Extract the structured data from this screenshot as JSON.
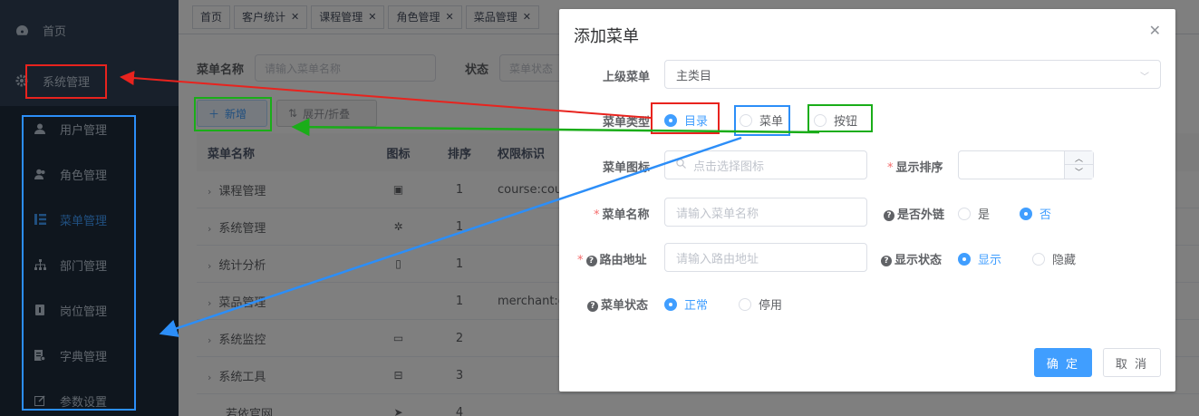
{
  "sidebar": {
    "home": "首页",
    "system": "系统管理",
    "items": [
      {
        "label": "用户管理",
        "icon": "user-icon"
      },
      {
        "label": "角色管理",
        "icon": "peoples-icon"
      },
      {
        "label": "菜单管理",
        "icon": "tree-table-icon",
        "active": true
      },
      {
        "label": "部门管理",
        "icon": "tree-icon"
      },
      {
        "label": "岗位管理",
        "icon": "post-icon"
      },
      {
        "label": "字典管理",
        "icon": "dict-icon"
      },
      {
        "label": "参数设置",
        "icon": "edit-icon"
      }
    ]
  },
  "tags": [
    "首页",
    "客户统计",
    "课程管理",
    "角色管理",
    "菜品管理"
  ],
  "search": {
    "name_label": "菜单名称",
    "name_placeholder": "请输入菜单名称",
    "status_label": "状态",
    "status_placeholder": "菜单状态"
  },
  "toolbar": {
    "new": "新增",
    "expand": "展开/折叠"
  },
  "table": {
    "headers": [
      "菜单名称",
      "图标",
      "排序",
      "权限标识"
    ],
    "rows": [
      {
        "name": "课程管理",
        "icon": "documentation-icon",
        "order": "1",
        "perm": "course:cou"
      },
      {
        "name": "系统管理",
        "icon": "system-icon",
        "order": "1",
        "perm": ""
      },
      {
        "name": "统计分析",
        "icon": "phone-icon",
        "order": "1",
        "perm": ""
      },
      {
        "name": "菜品管理",
        "icon": "",
        "order": "1",
        "perm": "merchant:d"
      },
      {
        "name": "系统监控",
        "icon": "monitor-icon",
        "order": "2",
        "perm": ""
      },
      {
        "name": "系统工具",
        "icon": "tool-icon",
        "order": "3",
        "perm": ""
      },
      {
        "name": "若依官网",
        "icon": "guide-icon",
        "order": "4",
        "perm": ""
      }
    ]
  },
  "dialog": {
    "title": "添加菜单",
    "parent_label": "上级菜单",
    "parent_value": "主类目",
    "type_label": "菜单类型",
    "type_options": [
      "目录",
      "菜单",
      "按钮"
    ],
    "icon_label": "菜单图标",
    "icon_placeholder": "点击选择图标",
    "order_label": "显示排序",
    "name_label": "菜单名称",
    "name_placeholder": "请输入菜单名称",
    "external_label": "是否外链",
    "external_options": [
      "是",
      "否"
    ],
    "path_label": "路由地址",
    "path_placeholder": "请输入路由地址",
    "visible_label": "显示状态",
    "visible_options": [
      "显示",
      "隐藏"
    ],
    "status_label": "菜单状态",
    "status_options": [
      "正常",
      "停用"
    ],
    "ok": "确 定",
    "cancel": "取 消"
  },
  "colors": {
    "primary": "#409eff",
    "annot_red": "#e8231e",
    "annot_green": "#1aad19",
    "annot_blue": "#2c8ef8"
  }
}
